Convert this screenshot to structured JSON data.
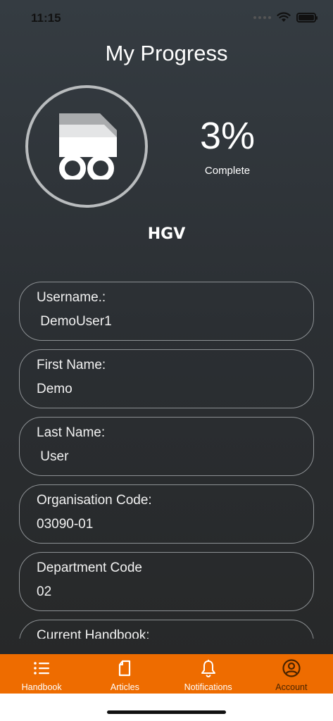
{
  "status_bar": {
    "time": "11:15"
  },
  "header": {
    "title": "My Progress"
  },
  "progress": {
    "value_text": "3%",
    "caption": "Complete",
    "fraction": 0.03
  },
  "course": {
    "name": "HGV"
  },
  "fields": [
    {
      "label": "Username.:",
      "value": " DemoUser1"
    },
    {
      "label": "First Name:",
      "value": "Demo"
    },
    {
      "label": "Last Name:",
      "value": " User"
    },
    {
      "label": "Organisation Code:",
      "value": "03090-01"
    },
    {
      "label": "Department Code",
      "value": "02"
    },
    {
      "label": "Current Handbook:",
      "value": ""
    }
  ],
  "tab_bar": {
    "tabs": [
      {
        "label": "Handbook",
        "icon": "list-icon"
      },
      {
        "label": "Articles",
        "icon": "document-icon"
      },
      {
        "label": "Notifications",
        "icon": "bell-icon"
      },
      {
        "label": "Account",
        "icon": "account-icon"
      }
    ],
    "active_index": 3
  },
  "colors": {
    "accent": "#ee6c00",
    "background": "#2e3338",
    "border": "#8d9194"
  }
}
